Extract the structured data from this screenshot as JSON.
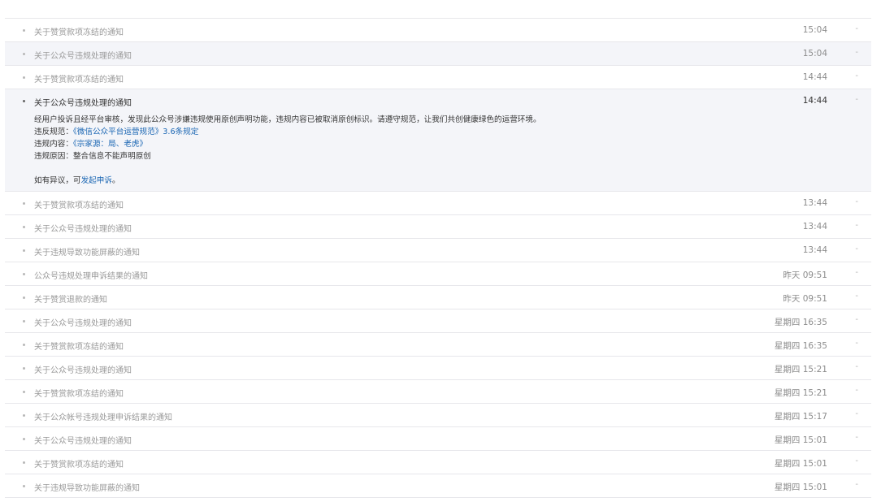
{
  "messages": [
    {
      "title": "关于赞赏款项冻结的通知",
      "time": "15:04"
    },
    {
      "title": "关于公众号违规处理的通知",
      "time": "15:04"
    },
    {
      "title": "关于赞赏款项冻结的通知",
      "time": "14:44"
    },
    {
      "title": "关于公众号违规处理的通知",
      "time": "14:44"
    },
    {
      "title": "关于赞赏款项冻结的通知",
      "time": "13:44"
    },
    {
      "title": "关于公众号违规处理的通知",
      "time": "13:44"
    },
    {
      "title": "关于违规导致功能屏蔽的通知",
      "time": "13:44"
    },
    {
      "title": "公众号违规处理申诉结果的通知",
      "time": "昨天 09:51"
    },
    {
      "title": "关于赞赏退款的通知",
      "time": "昨天 09:51"
    },
    {
      "title": "关于公众号违规处理的通知",
      "time": "星期四 16:35"
    },
    {
      "title": "关于赞赏款项冻结的通知",
      "time": "星期四 16:35"
    },
    {
      "title": "关于公众号违规处理的通知",
      "time": "星期四 15:21"
    },
    {
      "title": "关于赞赏款项冻结的通知",
      "time": "星期四 15:21"
    },
    {
      "title": "关于公众帐号违规处理申诉结果的通知",
      "time": "星期四 15:17"
    },
    {
      "title": "关于公众号违规处理的通知",
      "time": "星期四 15:01"
    },
    {
      "title": "关于赞赏款项冻结的通知",
      "time": "星期四 15:01"
    },
    {
      "title": "关于违规导致功能屏蔽的通知",
      "time": "星期四 15:01"
    }
  ],
  "toggle_symbol": "-",
  "detail": {
    "intro": "经用户投诉且经平台审核，发现此公众号涉嫌违规使用原创声明功能，违规内容已被取消原创标识。请遵守规范，让我们共创健康绿色的运营环境。",
    "rule_label": "违反规范：",
    "rule_link": "《微信公众平台运营规范》3.6条规定",
    "content_label": "违规内容：",
    "content_link": "《宗家源：局、老虎》",
    "reason_label": "违规原因：",
    "reason_text": "整合信息不能声明原创",
    "appeal_prefix": "如有异议，可",
    "appeal_link": "发起申诉",
    "appeal_suffix": "。"
  }
}
